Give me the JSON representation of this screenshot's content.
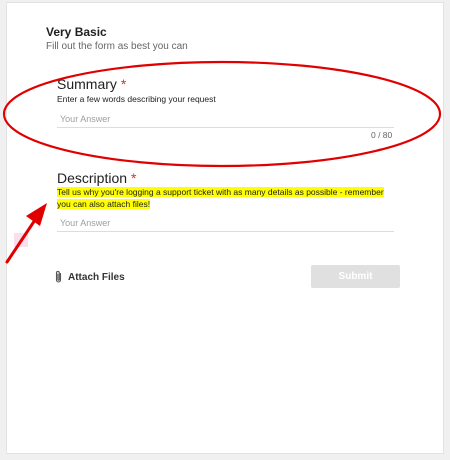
{
  "form": {
    "title": "Very Basic",
    "subtitle": "Fill out the form as best you can"
  },
  "questions": [
    {
      "label": "Summary",
      "required_mark": "*",
      "description": "Enter a few words describing your request",
      "placeholder": "Your Answer",
      "counter": "0 / 80"
    },
    {
      "label": "Description",
      "required_mark": "*",
      "description": "Tell us why you're logging a support ticket with as many details as possible - remember you can also attach files!",
      "placeholder": "Your Answer"
    }
  ],
  "actions": {
    "attach_label": "Attach Files",
    "attach_icon": "paperclip-icon",
    "submit_label": "Submit"
  },
  "annotations": {
    "ellipse_color": "#e00000",
    "arrow_color": "#e00000",
    "highlight_color": "#ffff00"
  },
  "colors": {
    "required": "#d93025",
    "submit_disabled_bg": "#e0e0e0"
  }
}
